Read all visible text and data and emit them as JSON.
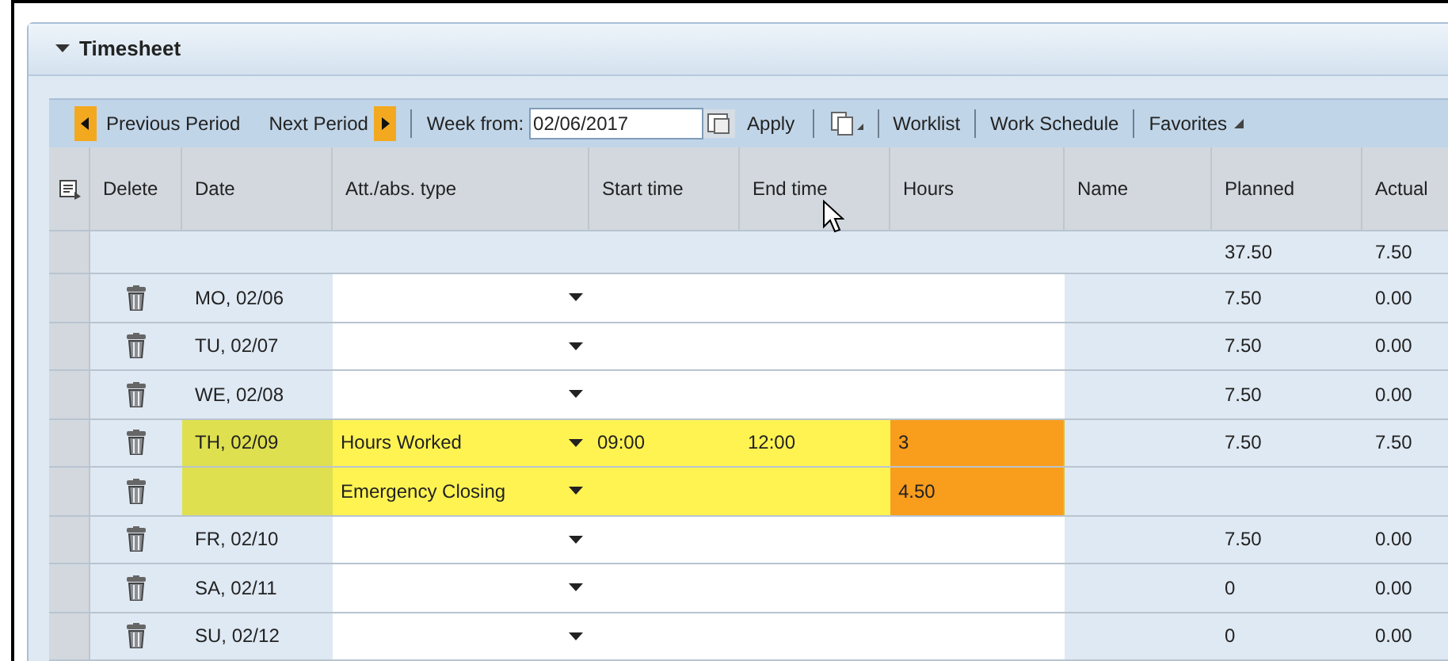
{
  "panel": {
    "title": "Timesheet",
    "expanded": true
  },
  "toolbar": {
    "previous": "Previous Period",
    "next": "Next Period",
    "week_label": "Week from:",
    "week_value": "02/06/2017",
    "apply": "Apply",
    "worklist": "Worklist",
    "work_schedule": "Work Schedule",
    "favorites": "Favorites"
  },
  "table": {
    "columns": [
      "Delete",
      "Date",
      "Att./abs. type",
      "Start time",
      "End time",
      "Hours",
      "Name",
      "Planned",
      "Actual"
    ],
    "totals": {
      "planned": "37.50",
      "actual": "7.50"
    },
    "rows": [
      {
        "date": "MO, 02/06",
        "type": "",
        "start": "",
        "end": "",
        "hours": "",
        "planned": "7.50",
        "actual": "0.00",
        "highlighted": false
      },
      {
        "date": "TU, 02/07",
        "type": "",
        "start": "",
        "end": "",
        "hours": "",
        "planned": "7.50",
        "actual": "0.00",
        "highlighted": false
      },
      {
        "date": "WE, 02/08",
        "type": "",
        "start": "",
        "end": "",
        "hours": "",
        "planned": "7.50",
        "actual": "0.00",
        "highlighted": false
      },
      {
        "date": "TH, 02/09",
        "type": "Hours Worked",
        "start": "09:00",
        "end": "12:00",
        "hours": "3",
        "planned": "7.50",
        "actual": "7.50",
        "highlighted": true
      },
      {
        "date": "",
        "type": "Emergency Closing",
        "start": "",
        "end": "",
        "hours": "4.50",
        "planned": "",
        "actual": "",
        "highlighted": true
      },
      {
        "date": "FR, 02/10",
        "type": "",
        "start": "",
        "end": "",
        "hours": "",
        "planned": "7.50",
        "actual": "0.00",
        "highlighted": false
      },
      {
        "date": "SA, 02/11",
        "type": "",
        "start": "",
        "end": "",
        "hours": "",
        "planned": "0",
        "actual": "0.00",
        "highlighted": false
      },
      {
        "date": "SU, 02/12",
        "type": "",
        "start": "",
        "end": "",
        "hours": "",
        "planned": "0",
        "actual": "0.00",
        "highlighted": false
      }
    ]
  }
}
